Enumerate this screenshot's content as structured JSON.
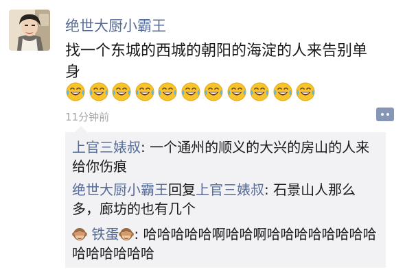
{
  "post": {
    "author": "绝世大厨小霸王",
    "text": "找一个东城的西城的朝阳的海淀的人来告别单身",
    "emoji_icon": "laughing-tears-emoji",
    "emoji_count": 11,
    "time": "11分钟前"
  },
  "comments": [
    {
      "author": "上官三婊叔",
      "separator": ": ",
      "text": "一个通州的顺义的大兴的房山的人来给你伤痕"
    },
    {
      "author": "绝世大厨小霸王",
      "reply_word": "回复",
      "reply_to": "上官三婊叔",
      "separator": ": ",
      "text": "石景山人那么多，廊坊的也有几个"
    },
    {
      "author": "铁蛋",
      "author_icon": "see-no-evil-monkey-emoji",
      "separator": ": ",
      "text": "哈哈哈哈哈啊哈哈啊哈哈哈哈哈哈哈哈哈哈哈哈哈哈"
    }
  ],
  "colors": {
    "name_link": "#576b95",
    "comment_bg": "#f2f2f5",
    "time_text": "#a6a6a6",
    "comment_button": "#8596b6"
  }
}
